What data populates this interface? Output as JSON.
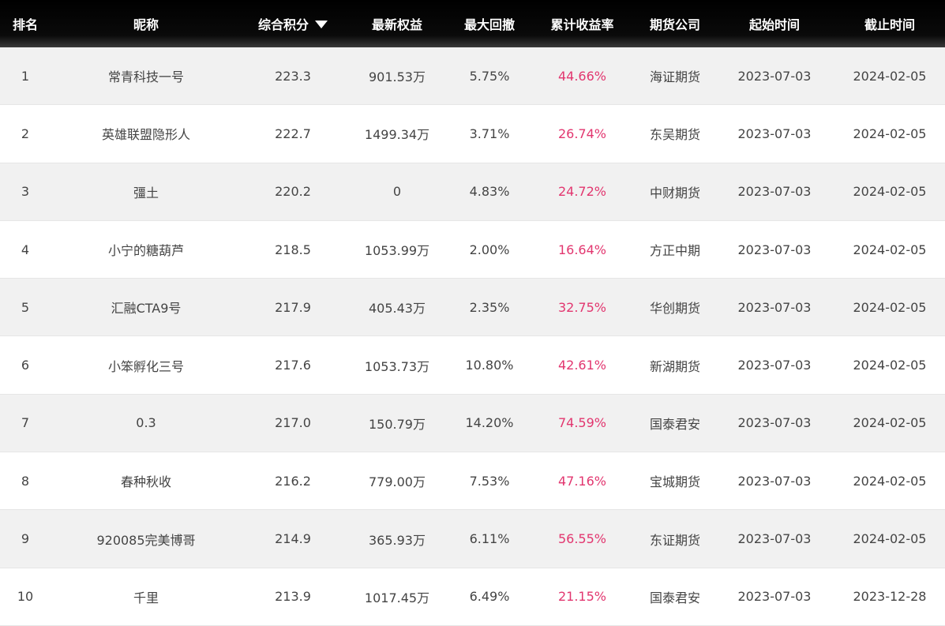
{
  "colors": {
    "header_bg": "#000000",
    "header_text": "#ffffff",
    "row_odd_bg": "#f1f1f1",
    "row_even_bg": "#ffffff",
    "text": "#444444",
    "return_color": "#e2366f"
  },
  "header": {
    "rank": "排名",
    "name": "昵称",
    "score": "综合积分",
    "score_sort_icon": "caret-down-icon",
    "equity": "最新权益",
    "drawdown": "最大回撤",
    "return": "累计收益率",
    "company": "期货公司",
    "start": "起始时间",
    "end": "截止时间"
  },
  "rows": [
    {
      "rank": "1",
      "name": "常青科技一号",
      "score": "223.3",
      "equity": "901.53万",
      "drawdown": "5.75%",
      "return": "44.66%",
      "company": "海证期货",
      "start": "2023-07-03",
      "end": "2024-02-05"
    },
    {
      "rank": "2",
      "name": "英雄联盟隐形人",
      "score": "222.7",
      "equity": "1499.34万",
      "drawdown": "3.71%",
      "return": "26.74%",
      "company": "东吴期货",
      "start": "2023-07-03",
      "end": "2024-02-05"
    },
    {
      "rank": "3",
      "name": "彊土",
      "score": "220.2",
      "equity": "0",
      "drawdown": "4.83%",
      "return": "24.72%",
      "company": "中财期货",
      "start": "2023-07-03",
      "end": "2024-02-05"
    },
    {
      "rank": "4",
      "name": "小宁的糖葫芦",
      "score": "218.5",
      "equity": "1053.99万",
      "drawdown": "2.00%",
      "return": "16.64%",
      "company": "方正中期",
      "start": "2023-07-03",
      "end": "2024-02-05"
    },
    {
      "rank": "5",
      "name": "汇融CTA9号",
      "score": "217.9",
      "equity": "405.43万",
      "drawdown": "2.35%",
      "return": "32.75%",
      "company": "华创期货",
      "start": "2023-07-03",
      "end": "2024-02-05"
    },
    {
      "rank": "6",
      "name": "小笨孵化三号",
      "score": "217.6",
      "equity": "1053.73万",
      "drawdown": "10.80%",
      "return": "42.61%",
      "company": "新湖期货",
      "start": "2023-07-03",
      "end": "2024-02-05"
    },
    {
      "rank": "7",
      "name": "0.3",
      "score": "217.0",
      "equity": "150.79万",
      "drawdown": "14.20%",
      "return": "74.59%",
      "company": "国泰君安",
      "start": "2023-07-03",
      "end": "2024-02-05"
    },
    {
      "rank": "8",
      "name": "春种秋收",
      "score": "216.2",
      "equity": "779.00万",
      "drawdown": "7.53%",
      "return": "47.16%",
      "company": "宝城期货",
      "start": "2023-07-03",
      "end": "2024-02-05"
    },
    {
      "rank": "9",
      "name": "920085完美博哥",
      "score": "214.9",
      "equity": "365.93万",
      "drawdown": "6.11%",
      "return": "56.55%",
      "company": "东证期货",
      "start": "2023-07-03",
      "end": "2024-02-05"
    },
    {
      "rank": "10",
      "name": "千里",
      "score": "213.9",
      "equity": "1017.45万",
      "drawdown": "6.49%",
      "return": "21.15%",
      "company": "国泰君安",
      "start": "2023-07-03",
      "end": "2023-12-28"
    }
  ]
}
